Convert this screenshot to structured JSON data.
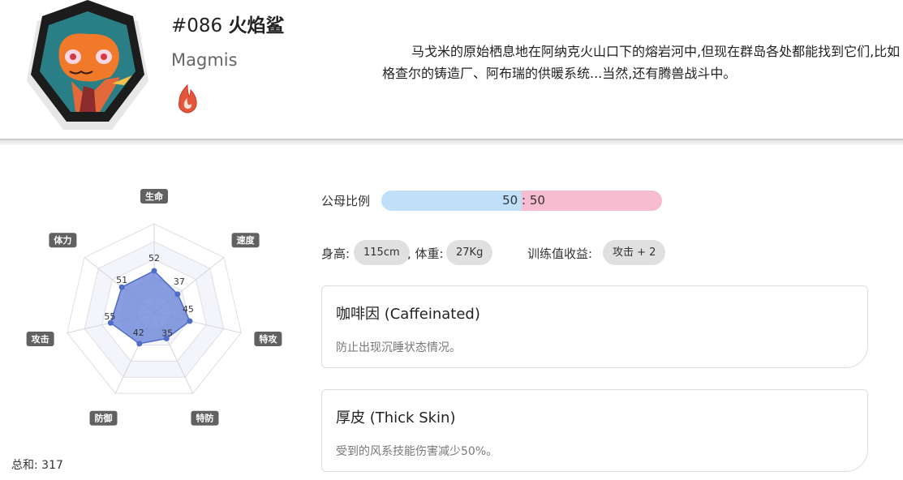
{
  "header": {
    "number": "#086",
    "name_cn": "火焰鲨",
    "name_en": "Magmis",
    "type_icon": "fire-type-icon",
    "description": "马戈米的原始栖息地在阿纳克火山口下的熔岩河中,但现在群岛各处都能找到它们,比如格查尔的铸造厂、阿布瑞的供暖系统...当然,还有腾兽战斗中。"
  },
  "stats": {
    "labels": [
      "生命",
      "速度",
      "特攻",
      "特防",
      "防御",
      "攻击",
      "体力"
    ],
    "values": [
      52,
      37,
      45,
      35,
      42,
      55,
      51
    ],
    "display_values": [
      "52",
      "37",
      "45",
      "35",
      "42",
      "55",
      "51"
    ],
    "max": 110,
    "total_label": "总和: 317"
  },
  "info": {
    "gender_label": "公母比例",
    "gender_male": "50",
    "gender_separator": ":",
    "gender_female": "50",
    "height_label": "身高:",
    "height_value": "115cm",
    "weight_label": ", 体重:",
    "weight_value": "27Kg",
    "training_label": "训练值收益:",
    "training_value": "攻击 + 2"
  },
  "traits": [
    {
      "title": "咖啡因 (Caffeinated)",
      "desc": "防止出现沉睡状态情况。"
    },
    {
      "title": "厚皮 (Thick Skin)",
      "desc": "受到的风系技能伤害减少50%。"
    }
  ],
  "colors": {
    "radar_fill": "#6f89d9",
    "radar_stroke": "#4f6cc9",
    "label_bg": "#616161",
    "male": "#bfe0f8",
    "female": "#f8bcd0",
    "pill": "#e0e0e0"
  }
}
